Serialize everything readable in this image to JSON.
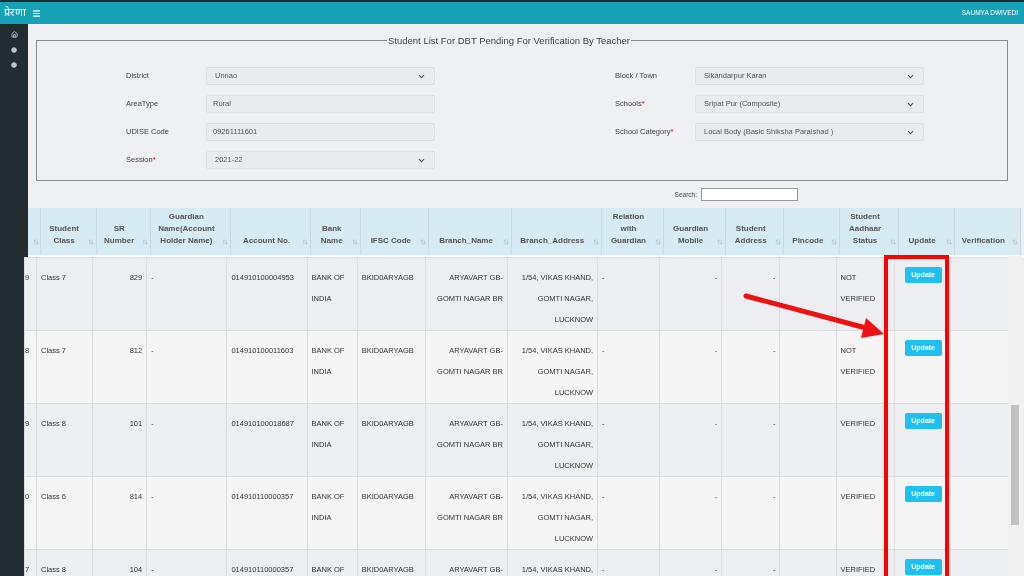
{
  "app": {
    "logo": "प्रेरणा",
    "user": "SAUMYA DWIVEDI"
  },
  "filters": {
    "title": "Student List For DBT Pending For Verification By Teacher",
    "left": [
      {
        "label": "District",
        "kind": "select",
        "value": "Unnao"
      },
      {
        "label": "AreaType",
        "kind": "input",
        "value": "Rural"
      },
      {
        "label": "UDISE Code",
        "kind": "input",
        "value": "09261111601"
      },
      {
        "label": "Session",
        "required_mark": "*",
        "kind": "select",
        "value": "2021-22"
      }
    ],
    "right": [
      {
        "label": "Block / Town",
        "kind": "select",
        "value": "Sikandarpur Karan"
      },
      {
        "label": "Schools",
        "required_mark": "*",
        "kind": "select",
        "value": "Sripat Pur (Composite)"
      },
      {
        "label": "School Category",
        "required_mark": "*",
        "kind": "select",
        "value": "Local Body (Basic Shiksha Paraishad )"
      }
    ]
  },
  "search": {
    "label": "Search:"
  },
  "table": {
    "columns": [
      "Student Class",
      "SR Number",
      "Guardian Name(Account Holder Name)",
      "Account No.",
      "Bank Name",
      "IFSC Code",
      "Branch_Name",
      "Branch_Address",
      "Relation with Guardian",
      "Guardian Mobile",
      "Student Address",
      "Pincode",
      "Student Aadhaar Status",
      "Update",
      "Verification"
    ],
    "rows": [
      {
        "column_1": "9",
        "student_class": "Class 7",
        "sr_number": "829",
        "guardian_name": "-",
        "account_no": "014910100004953",
        "bank_name": "BANK OF INDIA",
        "ifsc_code": "BKID0ARYAGB",
        "branch_name": "ARYAVART GB-GOMTI NAGAR BR",
        "branch_address": "1/54, VIKAS KHAND, GOMTI NAGAR, LUCKNOW",
        "relation": "-",
        "guardian_mobile": "-",
        "student_address": "-",
        "aadhaar_status": "NOT VERIFIED",
        "update": "Update"
      },
      {
        "column_1": "8",
        "student_class": "Class 7",
        "sr_number": "812",
        "guardian_name": "-",
        "account_no": "014910100011603",
        "bank_name": "BANK OF INDIA",
        "ifsc_code": "BKID0ARYAGB",
        "branch_name": "ARYAVART GB-GOMTI NAGAR BR",
        "branch_address": "1/54, VIKAS KHAND, GOMTI NAGAR, LUCKNOW",
        "relation": "-",
        "guardian_mobile": "-",
        "student_address": "-",
        "aadhaar_status": "NOT VERIFIED",
        "update": "Update"
      },
      {
        "column_1": "9",
        "student_class": "Class 8",
        "sr_number": "101",
        "guardian_name": "-",
        "account_no": "014910100018687",
        "bank_name": "BANK OF INDIA",
        "ifsc_code": "BKID0ARYAGB",
        "branch_name": "ARYAVART GB-GOMTI NAGAR BR",
        "branch_address": "1/54, VIKAS KHAND, GOMTI NAGAR, LUCKNOW",
        "relation": "-",
        "guardian_mobile": "-",
        "student_address": "-",
        "aadhaar_status": "VERIFIED",
        "update": "Update"
      },
      {
        "column_1": "0",
        "student_class": "Class 6",
        "sr_number": "814",
        "guardian_name": "-",
        "account_no": "014910110000357",
        "bank_name": "BANK OF INDIA",
        "ifsc_code": "BKID0ARYAGB",
        "branch_name": "ARYAVART GB-GOMTI NAGAR BR",
        "branch_address": "1/54, VIKAS KHAND, GOMTI NAGAR, LUCKNOW",
        "relation": "-",
        "guardian_mobile": "-",
        "student_address": "-",
        "aadhaar_status": "VERIFIED",
        "update": "Update"
      },
      {
        "column_1": "7",
        "student_class": "Class 8",
        "sr_number": "104",
        "guardian_name": "-",
        "account_no": "014910110000357",
        "bank_name": "BANK OF",
        "ifsc_code": "BKID0ARYAGB",
        "branch_name": "ARYAVART GB-",
        "branch_address": "1/54, VIKAS KHAND,",
        "relation": "-",
        "guardian_mobile": "-",
        "student_address": "-",
        "aadhaar_status": "VERIFIED",
        "update": "Update"
      }
    ]
  }
}
